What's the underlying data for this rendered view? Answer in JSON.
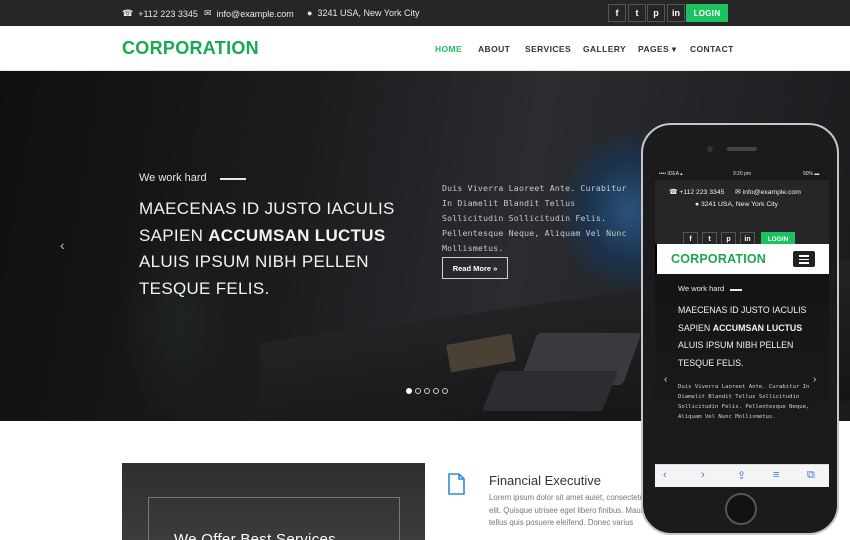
{
  "topbar": {
    "phone": "+112 223 3345",
    "email": "info@example.com",
    "address": "3241 USA, New York City",
    "social": [
      "f",
      "t",
      "p",
      "in"
    ],
    "login": "LOGIN"
  },
  "nav": {
    "logo": "CORPORATION",
    "items": [
      "HOME",
      "ABOUT",
      "SERVICES",
      "GALLERY",
      "PAGES ▾",
      "CONTACT"
    ]
  },
  "hero": {
    "kicker": "We work hard",
    "headline_pre": "MAECENAS ID JUSTO IACULIS SAPIEN ",
    "headline_bold": "ACCUMSAN LUCTUS",
    "headline_post": " ALUIS IPSUM NIBH PELLEN TESQUE FELIS.",
    "paragraph": "Duis Viverra Laoreet Ante. Curabitur In Diamelit Blandit Tellus Sollicitudin Sollicitudin Felis. Pellentesque Neque, Aliquam Vel Nunc Mollismetus.",
    "read_more": "Read More »",
    "slides": 5,
    "active_slide": 1,
    "prev": "‹"
  },
  "feature": {
    "image_text": "We Offer Best Services",
    "title": "Financial Executive",
    "text_lines": [
      "Lorem ipsum dolor sit amet auiet, consectetur",
      "elit. Quisque utrisee eget libero finibus. Mauris",
      "tellus quis posuere eleifend. Donec varius"
    ]
  },
  "phone": {
    "status_carrier": "•••• IDEA ▴",
    "status_time": "9:20 pm",
    "status_battery": "90% ▬",
    "phone": "+112 223 3345",
    "email": "info@example.com",
    "address": "3241 USA, New York City",
    "social": [
      "f",
      "t",
      "p",
      "in"
    ],
    "login": "LOGIN",
    "logo": "CORPORATION",
    "kicker": "We work hard",
    "headline_pre": "MAECENAS ID JUSTO IACULIS SAPIEN ",
    "headline_bold": "ACCUMSAN LUCTUS",
    "headline_post": " ALUIS IPSUM NIBH PELLEN TESQUE FELIS.",
    "paragraph": "Duis Viverra Laoreet Ante. Curabitur In Diamelit Blandit Tellus Sollicitudin Sollicitudin Felis. Pellentesque Neque, Aliquam Vel Nunc Mollismetus.",
    "prev": "‹",
    "next": "›",
    "toolbar": [
      "‹",
      "›",
      "⇪",
      "≡",
      "⧉"
    ]
  },
  "colors": {
    "accent": "#1ec15f",
    "logo": "#1aa84f",
    "topbar": "#262626"
  }
}
